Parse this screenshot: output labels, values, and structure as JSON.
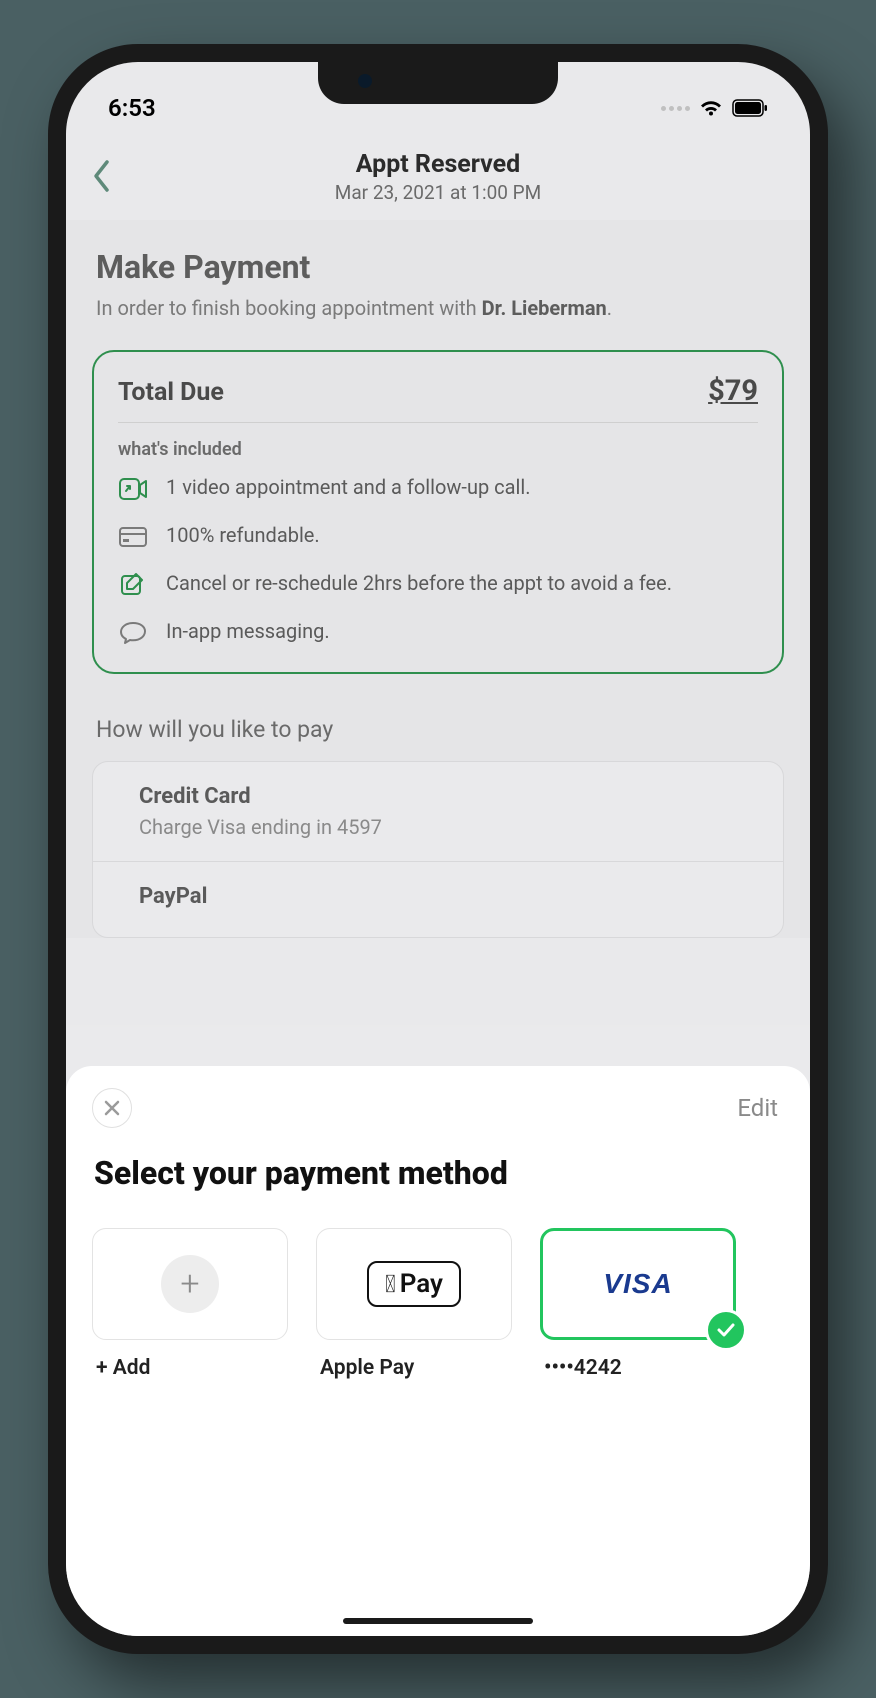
{
  "status": {
    "time": "6:53"
  },
  "header": {
    "title": "Appt Reserved",
    "subtitle": "Mar 23, 2021 at 1:00 PM"
  },
  "main": {
    "title": "Make Payment",
    "subtitle_prefix": "In order to finish booking  appointment with ",
    "subtitle_name": "Dr. Lieberman",
    "subtitle_suffix": "."
  },
  "total": {
    "label": "Total Due",
    "amount": "$79",
    "included_label": "what's included",
    "items": [
      "1 video appointment and a follow-up call.",
      "100% refundable.",
      "Cancel or re-schedule 2hrs before the appt to avoid a fee.",
      "In-app messaging."
    ]
  },
  "pay": {
    "question": "How will you like to pay",
    "options": [
      {
        "title": "Credit Card",
        "subtitle": "Charge Visa ending in 4597"
      },
      {
        "title": "PayPal",
        "subtitle": ""
      }
    ]
  },
  "sheet": {
    "edit": "Edit",
    "title": "Select your payment method",
    "methods": {
      "add_label": "+ Add",
      "applepay_label": "Apple Pay",
      "applepay_badge": "Pay",
      "visa_label": "••••4242",
      "visa_logo": "VISA"
    }
  }
}
